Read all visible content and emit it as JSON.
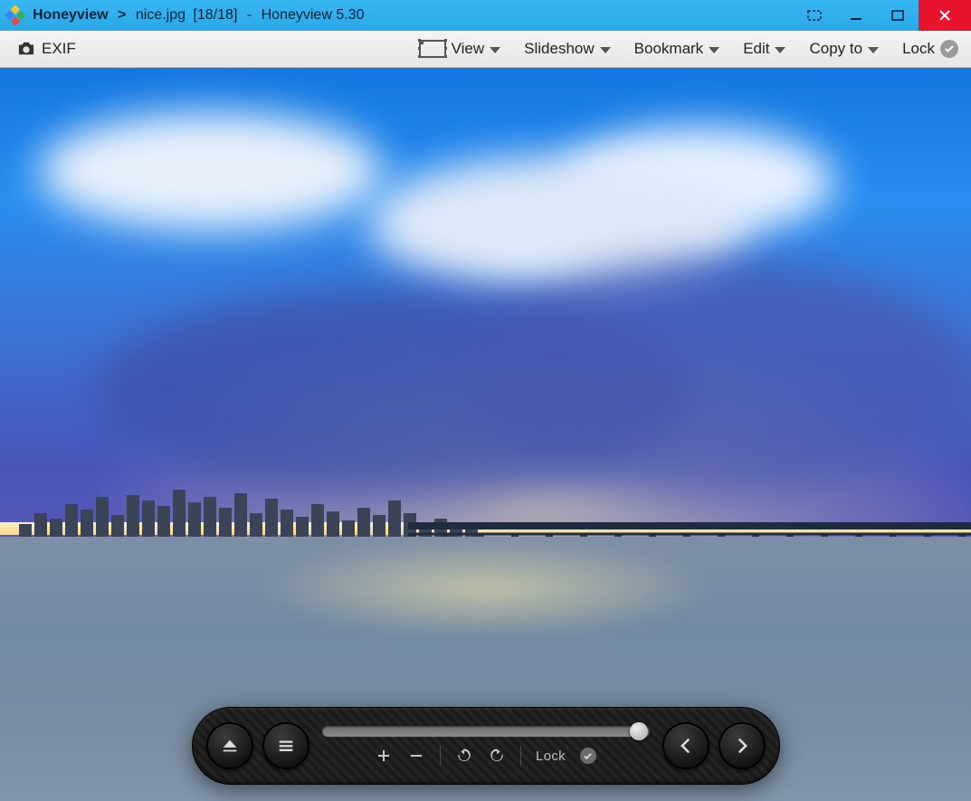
{
  "titlebar": {
    "app_name": "Honeyview",
    "separator": ">",
    "file_name": "nice.jpg",
    "counter": "[18/18]",
    "dash": "-",
    "app_full": "Honeyview 5.30"
  },
  "toolbar": {
    "exif_label": "EXIF",
    "menus": {
      "view": "View",
      "slideshow": "Slideshow",
      "bookmark": "Bookmark",
      "edit": "Edit",
      "copy_to": "Copy to",
      "lock": "Lock"
    }
  },
  "controlbar": {
    "lock_label": "Lock",
    "icons": {
      "eject": "eject-icon",
      "list": "list-icon",
      "zoom_in": "plus-icon",
      "zoom_out": "minus-icon",
      "rotate_ccw": "rotate-ccw-icon",
      "rotate_cw": "rotate-cw-icon",
      "prev": "chevron-left-icon",
      "next": "chevron-right-icon"
    }
  }
}
